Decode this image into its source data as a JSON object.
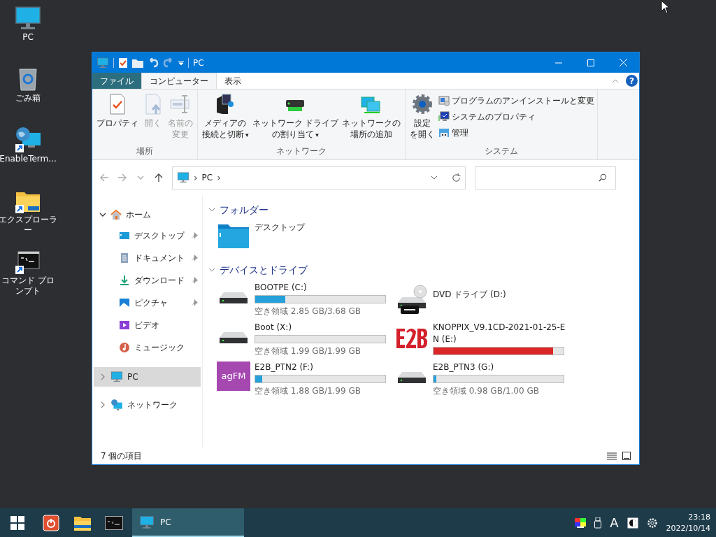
{
  "desktop_icons": [
    {
      "label": "PC",
      "kind": "pc"
    },
    {
      "label": "ごみ箱",
      "kind": "recycle"
    },
    {
      "label": "EnableTerm...",
      "kind": "globe"
    },
    {
      "label": "エクスプローラー",
      "kind": "folder"
    },
    {
      "label": "コマンド プロンプト",
      "kind": "cmd"
    }
  ],
  "window": {
    "title": "PC",
    "ribbon_tabs": [
      {
        "label": "ファイル",
        "kind": "file",
        "selected": false
      },
      {
        "label": "コンピューター",
        "kind": "tab",
        "selected": true
      },
      {
        "label": "表示",
        "kind": "tab",
        "selected": false
      }
    ],
    "help": "?",
    "ribbon_groups": [
      {
        "label": "場所",
        "buttons": [
          {
            "lines": [
              "プロパティ"
            ],
            "kind": "properties",
            "disabled": false
          },
          {
            "lines": [
              "開く"
            ],
            "kind": "open",
            "disabled": true
          },
          {
            "lines": [
              "名前の",
              "変更"
            ],
            "kind": "rename",
            "disabled": true
          }
        ]
      },
      {
        "label": "ネットワーク",
        "buttons": [
          {
            "lines": [
              "メディアの",
              "接続と切断"
            ],
            "kind": "media",
            "disabled": false,
            "caret": "▾"
          },
          {
            "lines": [
              "ネットワーク ドライブ",
              "の割り当て"
            ],
            "kind": "netdrive",
            "disabled": false,
            "caret": "▾"
          },
          {
            "lines": [
              "ネットワークの",
              "場所の追加"
            ],
            "kind": "netplace",
            "disabled": false
          }
        ]
      },
      {
        "label": "システム",
        "buttons": [
          {
            "lines": [
              "設定",
              "を開く"
            ],
            "kind": "settings",
            "disabled": false
          }
        ],
        "small_buttons": [
          {
            "label": "プログラムのアンインストールと変更",
            "kind": "uninstall"
          },
          {
            "label": "システムのプロパティ",
            "kind": "sysprops"
          },
          {
            "label": "管理",
            "kind": "manage"
          }
        ]
      }
    ],
    "address": {
      "parts": [
        {
          "kind": "sep",
          "text": "›"
        },
        {
          "kind": "crumb",
          "text": "PC"
        },
        {
          "kind": "sep",
          "text": "›"
        }
      ]
    },
    "nav": [
      {
        "label": "ホーム",
        "kind": "home",
        "expanded": true,
        "selected": false,
        "children": [
          {
            "label": "デスクトップ",
            "kind": "desktop",
            "pinned": true,
            "selected": false
          },
          {
            "label": "ドキュメント",
            "kind": "documents",
            "pinned": true,
            "selected": false
          },
          {
            "label": "ダウンロード",
            "kind": "downloads",
            "pinned": true,
            "selected": false
          },
          {
            "label": "ピクチャ",
            "kind": "pictures",
            "pinned": true,
            "selected": false
          },
          {
            "label": "ビデオ",
            "kind": "videos",
            "pinned": false,
            "selected": false
          },
          {
            "label": "ミュージック",
            "kind": "music",
            "pinned": false,
            "selected": false
          }
        ]
      },
      {
        "label": "PC",
        "kind": "pc",
        "expanded": false,
        "selected": true
      },
      {
        "label": "ネットワーク",
        "kind": "network",
        "expanded": false,
        "selected": false
      }
    ],
    "sections": [
      {
        "title": "フォルダー",
        "expanded": true,
        "items": [
          {
            "name": "デスクトップ",
            "kind": "folder"
          }
        ]
      },
      {
        "title": "デバイスとドライブ",
        "expanded": true,
        "items": [
          {
            "name": "BOOTPE (C:)",
            "kind": "drive",
            "level": 0.23,
            "color": "#26a0da",
            "free": "空き領域 2.85 GB/3.68 GB"
          },
          {
            "name": "DVD ドライブ (D:)",
            "kind": "dvd"
          },
          {
            "name": "Boot (X:)",
            "kind": "drive",
            "free": "空き領域 1.99 GB/1.99 GB"
          },
          {
            "name": "KNOPPIX_V9.1CD-2021-01-25-EN (E:)",
            "kind": "e2b",
            "level": 0.92,
            "color": "#da2626"
          },
          {
            "name": "E2B_PTN2 (F:)",
            "kind": "agfm",
            "level": 0.055,
            "color": "#26a0da",
            "free": "空き領域 1.88 GB/1.99 GB",
            "badge": "agFM"
          },
          {
            "name": "E2B_PTN3 (G:)",
            "kind": "drive",
            "level": 0.02,
            "color": "#26a0da",
            "free": "空き領域 0.98 GB/1.00 GB"
          }
        ]
      }
    ],
    "status": "7 個の項目"
  },
  "taskbar": {
    "pinned": [
      {
        "kind": "power"
      },
      {
        "kind": "explorer"
      },
      {
        "kind": "cmd"
      }
    ],
    "windows": [
      {
        "label": "PC",
        "selected": true
      }
    ],
    "ime": "A",
    "time": "23:18",
    "date": "2022/10/14"
  }
}
